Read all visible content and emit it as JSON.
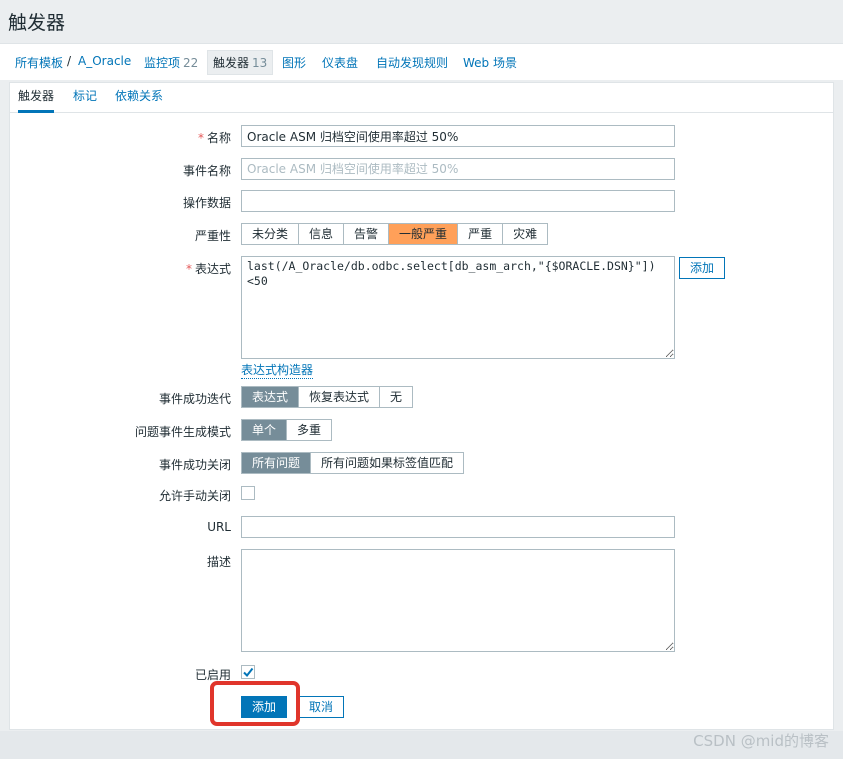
{
  "page": {
    "title": "触发器"
  },
  "breadcrumb": {
    "all_templates": "所有模板",
    "separator": "/",
    "template": "A_Oracle",
    "items": {
      "label": "监控项",
      "count": "22"
    },
    "triggers": {
      "label": "触发器",
      "count": "13"
    },
    "graphs": "图形",
    "dashboards": "仪表盘",
    "discovery": "自动发现规则",
    "web": "Web 场景"
  },
  "tabs": {
    "trigger": "触发器",
    "tags": "标记",
    "dependencies": "依赖关系"
  },
  "form": {
    "name": {
      "label": "名称",
      "required": "*",
      "value": "Oracle ASM 归档空间使用率超过 50%"
    },
    "event_name": {
      "label": "事件名称",
      "placeholder": "Oracle ASM 归档空间使用率超过 50%"
    },
    "opdata": {
      "label": "操作数据",
      "value": ""
    },
    "severity": {
      "label": "严重性",
      "options": [
        "未分类",
        "信息",
        "告警",
        "一般严重",
        "严重",
        "灾难"
      ],
      "selected": "一般严重",
      "selected_color": "#ffa059"
    },
    "expression": {
      "label": "表达式",
      "required": "*",
      "value": "last(/A_Oracle/db.odbc.select[db_asm_arch,\"{$ORACLE.DSN}\"])\n<50",
      "add_button": "添加",
      "builder_link": "表达式构造器"
    },
    "recovery_mode": {
      "label": "事件成功迭代",
      "options": [
        "表达式",
        "恢复表达式",
        "无"
      ],
      "selected": "表达式"
    },
    "problem_mode": {
      "label": "问题事件生成模式",
      "options": [
        "单个",
        "多重"
      ],
      "selected": "单个"
    },
    "ok_close": {
      "label": "事件成功关闭",
      "options": [
        "所有问题",
        "所有问题如果标签值匹配"
      ],
      "selected": "所有问题"
    },
    "manual_close": {
      "label": "允许手动关闭",
      "checked": false
    },
    "url": {
      "label": "URL",
      "value": ""
    },
    "description": {
      "label": "描述",
      "value": ""
    },
    "enabled": {
      "label": "已启用",
      "checked": true
    }
  },
  "actions": {
    "add": "添加",
    "cancel": "取消"
  },
  "watermark": "CSDN @mid的博客",
  "colors": {
    "accent": "#0275b8",
    "highlight_box": "#e0352b",
    "selected_segment": "#768d99"
  }
}
